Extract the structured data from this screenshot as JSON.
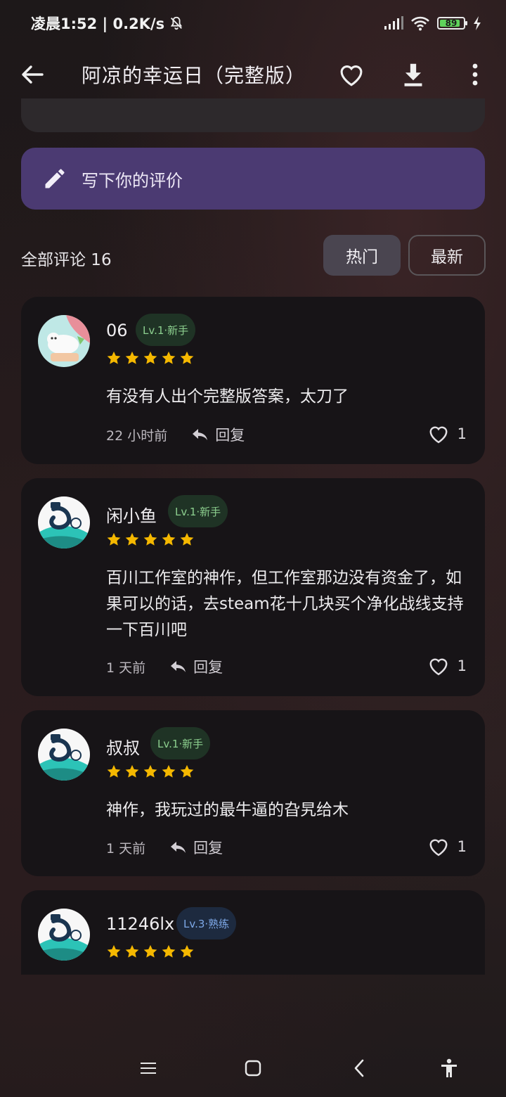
{
  "status_bar": {
    "time_speed": "凌晨1:52 | 0.2K/s",
    "battery": "89",
    "icons": [
      "mute-bell-icon",
      "signal-icon",
      "wifi-icon",
      "battery-icon",
      "charging-icon"
    ]
  },
  "app_bar": {
    "title": "阿凉的幸运日（完整版）",
    "icons": [
      "back-arrow-icon",
      "heart-icon",
      "download-icon",
      "more-icon"
    ]
  },
  "write_review": {
    "label": "写下你的评价",
    "icon": "pencil-icon"
  },
  "comments": {
    "count_label": "全部评论 16",
    "sort_hot": "热门",
    "sort_new": "最新",
    "items": [
      {
        "user": "06",
        "badge": "Lv.1·新手",
        "rating": 5,
        "text": "有没有人出个完整版答案，太刀了",
        "time": "22 小时前",
        "reply": "回复",
        "likes": "1"
      },
      {
        "user": "闲小鱼",
        "badge": "Lv.1·新手",
        "rating": 5,
        "text": "百川工作室的神作，但工作室那边没有资金了，如果可以的话，去steam花十几块买个净化战线支持一下百川吧",
        "time": "1 天前",
        "reply": "回复",
        "likes": "1"
      },
      {
        "user": "叔叔",
        "badge": "Lv.1·新手",
        "rating": 5,
        "text": "神作，我玩过的最牛逼的旮旯给木",
        "time": "1 天前",
        "reply": "回复",
        "likes": "1"
      },
      {
        "user": "11246lx",
        "badge": "Lv.3·熟练",
        "rating": 5
      }
    ]
  },
  "colors": {
    "accent_purple": "#4b3a72",
    "star": "#f5b800",
    "badge_green": "#8ccf8e",
    "badge_blue": "#7ea9e8"
  },
  "nav_bar": {
    "icons": [
      "menu-icon",
      "home-icon",
      "back-icon",
      "accessibility-icon"
    ]
  }
}
